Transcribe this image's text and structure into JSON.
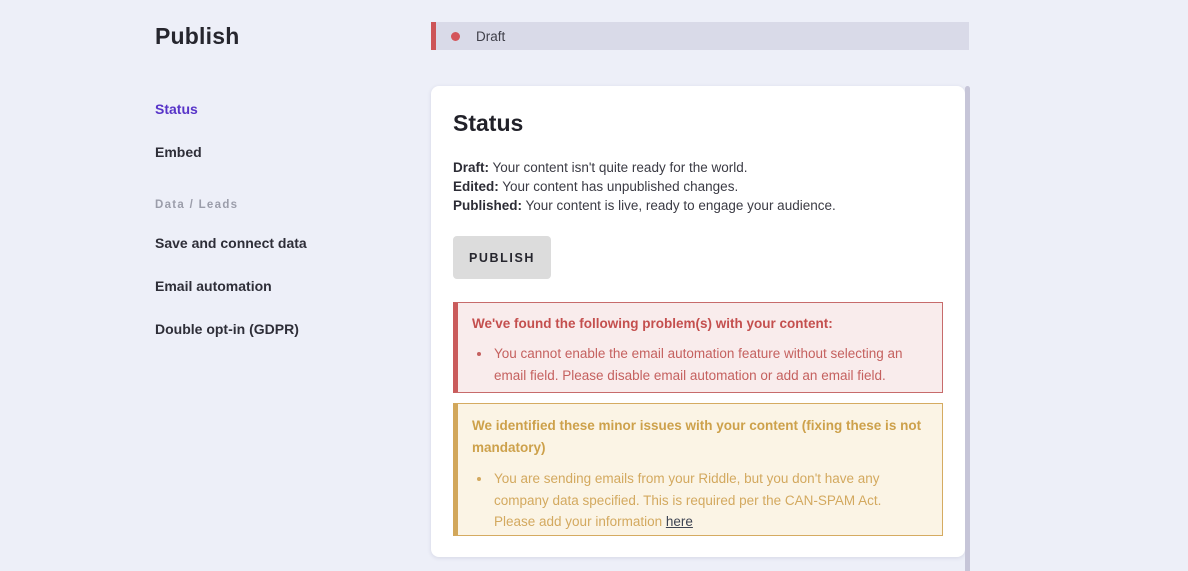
{
  "page": {
    "title": "Publish"
  },
  "sidebar": {
    "items": [
      {
        "label": "Status",
        "active": true
      },
      {
        "label": "Embed",
        "active": false
      }
    ],
    "section_label": "Data / Leads",
    "section_items": [
      {
        "label": "Save and connect data"
      },
      {
        "label": "Email automation"
      },
      {
        "label": "Double opt-in (GDPR)"
      }
    ]
  },
  "status_bar": {
    "label": "Draft"
  },
  "card": {
    "heading": "Status",
    "states": [
      {
        "label": "Draft:",
        "text": " Your content isn't quite ready for the world."
      },
      {
        "label": "Edited:",
        "text": " Your content has unpublished changes."
      },
      {
        "label": "Published:",
        "text": " Your content is live, ready to engage your audience."
      }
    ],
    "publish_button": "PUBLISH",
    "error_alert": {
      "heading": "We've found the following problem(s) with your content:",
      "items": [
        "You cannot enable the email automation feature without selecting an email field. Please disable email automation or add an email field."
      ]
    },
    "warning_alert": {
      "heading": "We identified these minor issues with your content (fixing these is not mandatory)",
      "item_text": "You are sending emails from your Riddle, but you don't have any company data specified. This is required per the CAN-SPAM Act. Please add your information ",
      "item_link": "here"
    }
  },
  "colors": {
    "page_background": "#edeff8",
    "draft_bar_background": "#d9dae8",
    "draft_accent_red": "#cd5457",
    "active_nav_purple": "#5733c8",
    "error_background": "#f9ecec",
    "error_text": "#c5615f",
    "warning_background": "#fbf4e5",
    "warning_text": "#d3a95f",
    "button_background": "#dcdcdc",
    "scrollbar": "#c6c5d8"
  }
}
